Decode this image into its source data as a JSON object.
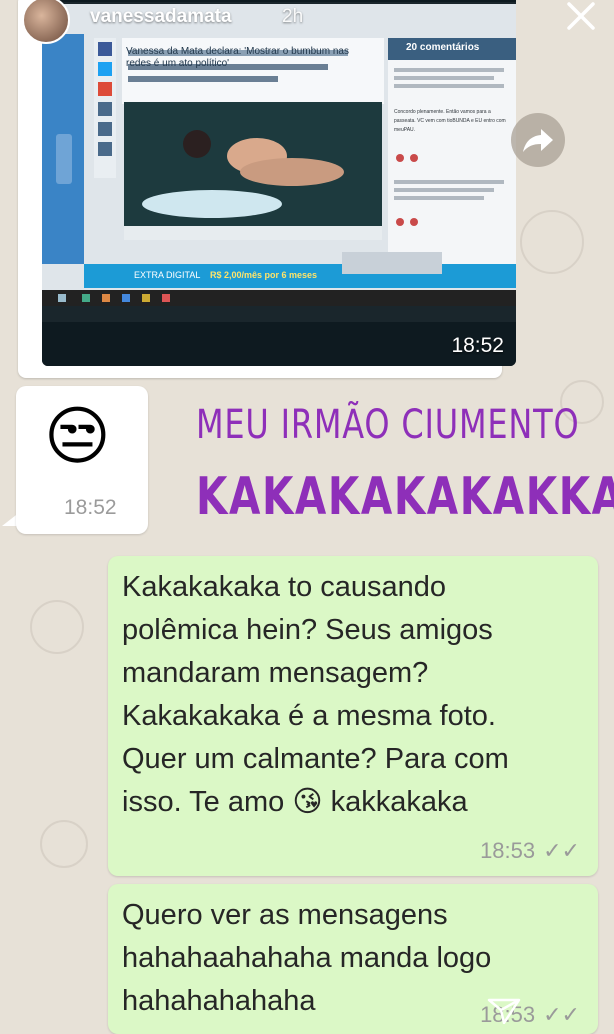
{
  "story": {
    "username": "vanessadamata",
    "time_ago": "2h"
  },
  "image_message": {
    "time": "18:52",
    "screen": {
      "headline": "Vanessa da Mata declara: 'Mostrar o bumbum nas redes é um ato político'",
      "comments_header": "20 comentários",
      "comment_preview": "Concordo plenamente. Então vamos para a passeata. VC vem com tioBUNDA e EU entro com meuPAU.",
      "banner_label": "EXTRA DIGITAL",
      "banner_offer": "R$ 2,00/mês por 6 meses"
    }
  },
  "emoji_message": {
    "emoji": "😒",
    "time": "18:52"
  },
  "caption": {
    "line1": "MEU IRMÃO CIUMENTO",
    "line2": "KAKAKAKAKAKKA"
  },
  "outgoing": [
    {
      "text": "Kakakakaka to causando\npolêmica hein? Seus amigos\nmandaram mensagem?\nKakakakaka é a mesma foto.\nQuer um calmante? Para com\nisso. Te amo 😘 kakkakaka",
      "time": "18:53",
      "status": "✓✓"
    },
    {
      "text": "Quero ver as mensagens\nhahahaahahaha manda logo\nhahahahahaha",
      "time": "18:53",
      "status": "✓✓"
    }
  ],
  "colors": {
    "caption": "#8e2fb9",
    "outgoing_bubble": "#dbf8c6",
    "chat_bg": "#e7e1d7"
  }
}
